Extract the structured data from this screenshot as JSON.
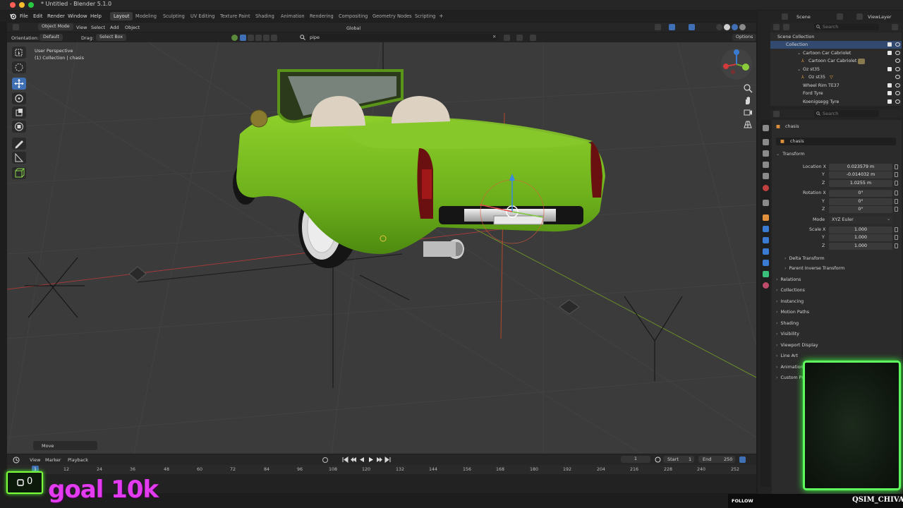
{
  "window": {
    "title": "* Untitled - Blender 5.1.0",
    "traffic_colors": [
      "#ff5f57",
      "#febc2e",
      "#28c840"
    ]
  },
  "topbar": {
    "menus": [
      "File",
      "Edit",
      "Render",
      "Window",
      "Help"
    ],
    "workspaces": [
      "Layout",
      "Modeling",
      "Sculpting",
      "UV Editing",
      "Texture Paint",
      "Shading",
      "Animation",
      "Rendering",
      "Compositing",
      "Geometry Nodes",
      "Scripting"
    ],
    "active_workspace": "Layout",
    "add_label": "+"
  },
  "viewport_header": {
    "mode": "Object Mode",
    "menus": [
      "View",
      "Select",
      "Add",
      "Object"
    ],
    "orientation_label": "Orientation:",
    "orientation_value": "Default",
    "drag_label": "Drag:",
    "drag_value": "Select Box",
    "search_value": "pipe",
    "transform_orientation": "Global",
    "options_label": "Options"
  },
  "viewport": {
    "view_name": "User Perspective",
    "context": "(1) Collection | chasis",
    "operator_panel": "Move",
    "grid_color": "#3b3b3b",
    "car_color": "#7cc423"
  },
  "timeline": {
    "menus": [
      "View",
      "Marker",
      "Playback"
    ],
    "current_frame": "1",
    "start_label": "Start",
    "start_value": "1",
    "end_label": "End",
    "end_value": "250",
    "ticks": [
      "1",
      "12",
      "24",
      "36",
      "48",
      "60",
      "72",
      "84",
      "96",
      "108",
      "120",
      "132",
      "144",
      "156",
      "168",
      "180",
      "192",
      "204",
      "216",
      "228",
      "240",
      "252"
    ]
  },
  "outliner": {
    "scene_label": "Scene",
    "viewlayer_label": "ViewLayer",
    "search_placeholder": "Search",
    "root": "Scene Collection",
    "rows": [
      {
        "label": "Collection",
        "selected": true
      },
      {
        "label": "Cartoon Car Cabriolet",
        "selected": false
      },
      {
        "label": "Cartoon Car Cabriolet",
        "selected": false
      },
      {
        "label": "Oz st35",
        "selected": false
      },
      {
        "label": "Oz st35",
        "selected": false
      },
      {
        "label": "Wheel Rim TE37",
        "selected": false
      },
      {
        "label": "Ford Tyre",
        "selected": false
      },
      {
        "label": "Koenigsegg Tyre",
        "selected": false
      }
    ]
  },
  "properties": {
    "search_placeholder": "Search",
    "object_path": "chasis",
    "object_name": "chasis",
    "transform_label": "Transform",
    "location_x_label": "Location X",
    "y_label": "Y",
    "z_label": "Z",
    "location": [
      "0.023579 m",
      "-0.014032 m",
      "1.0255 m"
    ],
    "rotation_x_label": "Rotation X",
    "rotation": [
      "0°",
      "0°",
      "0°"
    ],
    "mode_label": "Mode",
    "mode_value": "XYZ Euler",
    "scale_x_label": "Scale X",
    "scale": [
      "1.000",
      "1.000",
      "1.000"
    ],
    "subsections": [
      "Delta Transform",
      "Parent Inverse Transform"
    ],
    "sections": [
      "Relations",
      "Collections",
      "Instancing",
      "Motion Paths",
      "Shading",
      "Visibility",
      "Viewport Display",
      "Line Art",
      "Animation",
      "Custom Properties"
    ]
  },
  "overlay": {
    "subs_count": "0",
    "goal_text": "goal 10k",
    "follow_label": "FOLLOW",
    "streamer_name": "QSIM_CHIVA",
    "accent_green": "#5fff5f",
    "accent_magenta": "#e33cf0"
  }
}
